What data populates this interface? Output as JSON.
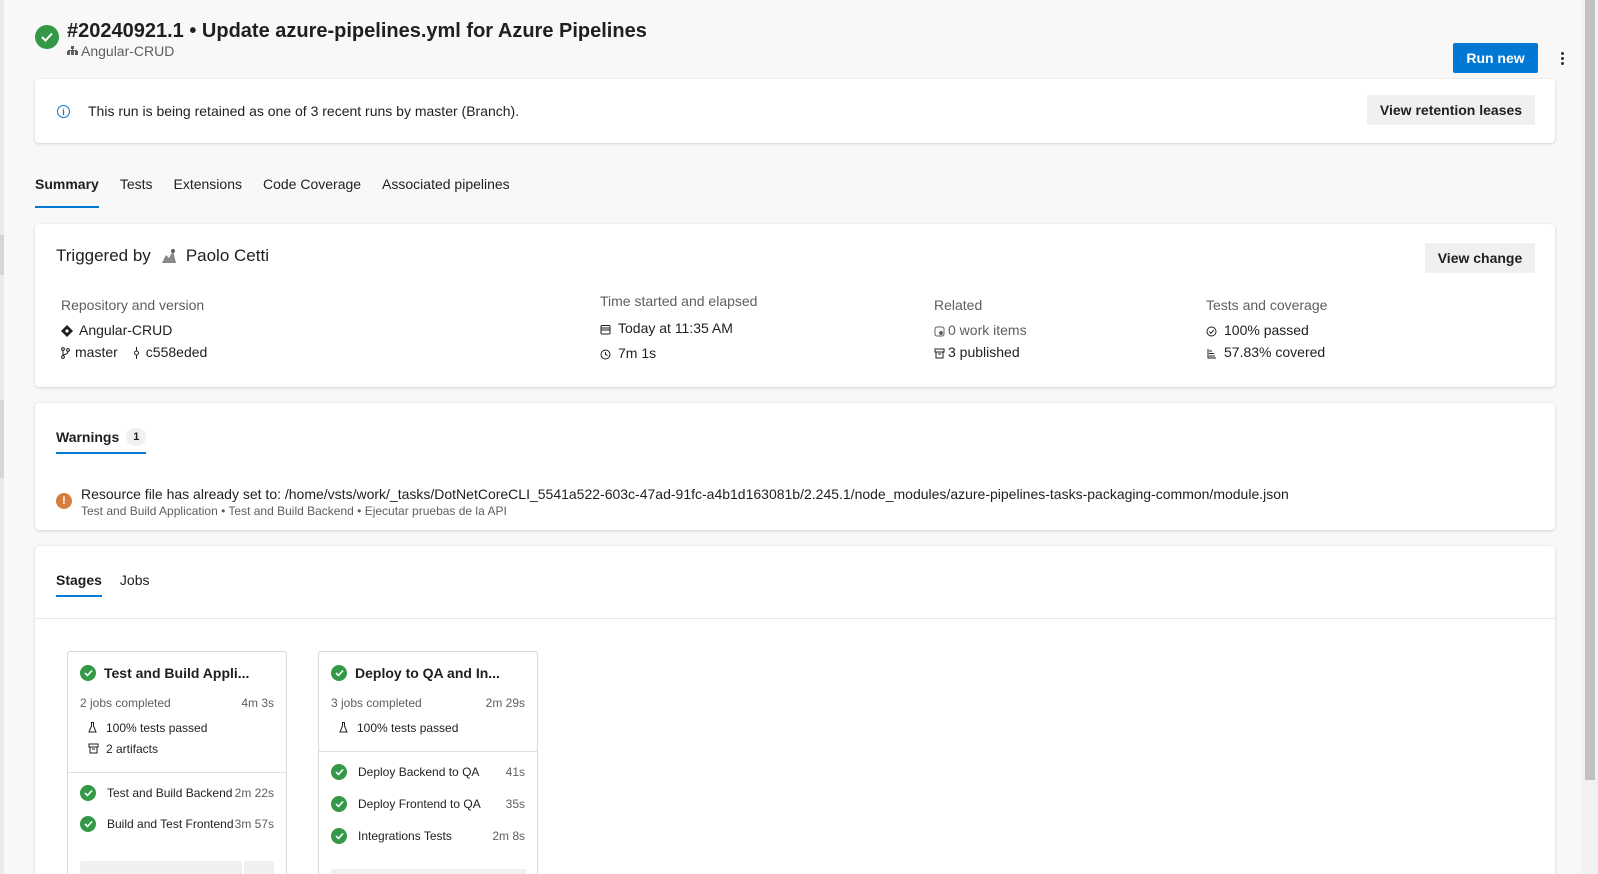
{
  "header": {
    "title": "#20240921.1 • Update azure-pipelines.yml for Azure Pipelines",
    "project": "Angular-CRUD",
    "run_new_label": "Run new"
  },
  "retention": {
    "message": "This run is being retained as one of 3 recent runs by master (Branch).",
    "button_label": "View retention leases"
  },
  "tabs": [
    "Summary",
    "Tests",
    "Extensions",
    "Code Coverage",
    "Associated pipelines"
  ],
  "trigger": {
    "label": "Triggered by",
    "user": "Paolo Cetti",
    "view_change_label": "View change",
    "repo": {
      "heading": "Repository and version",
      "name": "Angular-CRUD",
      "branch": "master",
      "commit": "c558eded"
    },
    "time": {
      "heading": "Time started and elapsed",
      "started": "Today at 11:35 AM",
      "elapsed": "7m 1s"
    },
    "related": {
      "heading": "Related",
      "work_items": "0 work items",
      "published": "3 published"
    },
    "tests": {
      "heading": "Tests and coverage",
      "passed": "100% passed",
      "covered": "57.83% covered"
    }
  },
  "warnings": {
    "tab_label": "Warnings",
    "count": "1",
    "message": "Resource file has already set to: /home/vsts/work/_tasks/DotNetCoreCLI_5541a522-603c-47ad-91fc-a4b1d163081b/2.245.1/node_modules/azure-pipelines-tasks-packaging-common/module.json",
    "source": "Test and Build Application • Test and Build Backend • Ejecutar pruebas de la API"
  },
  "stages": {
    "tabs": [
      "Stages",
      "Jobs"
    ],
    "cards": [
      {
        "title": "Test and Build Appli...",
        "jobs_completed": "2 jobs completed",
        "duration": "4m 3s",
        "tests": "100% tests passed",
        "artifacts": "2 artifacts",
        "jobs": [
          {
            "name": "Test and Build Backend",
            "duration": "2m 22s"
          },
          {
            "name": "Build and Test Frontend",
            "duration": "3m 57s"
          }
        ]
      },
      {
        "title": "Deploy to QA and In...",
        "jobs_completed": "3 jobs completed",
        "duration": "2m 29s",
        "tests": "100% tests passed",
        "jobs": [
          {
            "name": "Deploy Backend to QA",
            "duration": "41s"
          },
          {
            "name": "Deploy Frontend to QA",
            "duration": "35s"
          },
          {
            "name": "Integrations Tests",
            "duration": "2m 8s"
          }
        ]
      }
    ]
  },
  "colors": {
    "accent": "#0078d4",
    "success": "#339947",
    "warning": "#d67f3c"
  },
  "icons": {
    "status": "check-circle-icon",
    "info": "info-icon",
    "warning": "warning-icon",
    "more": "more-vertical-icon"
  }
}
